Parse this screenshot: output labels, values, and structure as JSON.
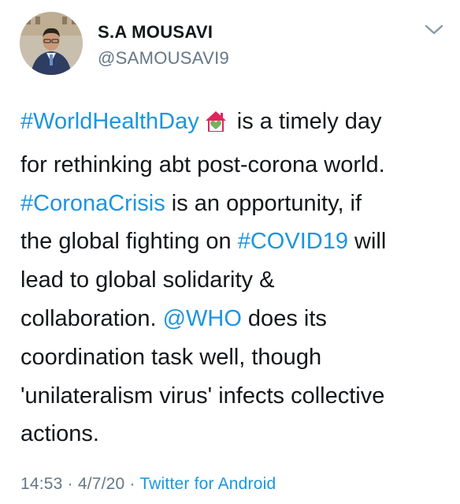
{
  "user": {
    "name": "S.A MOUSAVI",
    "handle": "@SAMOUSAVI9"
  },
  "icons": {
    "menu": "chevron-down-icon",
    "emoji": "house-with-heart-emoji",
    "avatar": "profile-photo"
  },
  "tweet": {
    "lines": [
      [
        {
          "t": "#WorldHealthDay",
          "link": true
        },
        {
          "emoji": true
        },
        {
          "t": " is a timely day"
        }
      ],
      [
        {
          "t": "for rethinking abt post-corona world."
        }
      ],
      [
        {
          "t": "#CoronaCrisis",
          "link": true
        },
        {
          "t": " is an opportunity, if"
        }
      ],
      [
        {
          "t": "the global fighting on "
        },
        {
          "t": "#COVID19",
          "link": true
        },
        {
          "t": " will"
        }
      ],
      [
        {
          "t": "lead to global solidarity &"
        }
      ],
      [
        {
          "t": "collaboration. "
        },
        {
          "t": "@WHO",
          "link": true
        },
        {
          "t": " does its"
        }
      ],
      [
        {
          "t": "coordination task well, though"
        }
      ],
      [
        {
          "t": "'unilateralism virus' infects collective"
        }
      ],
      [
        {
          "t": "actions."
        }
      ]
    ]
  },
  "meta": {
    "time": "14:53",
    "sep1": " · ",
    "date": "4/7/20",
    "sep2": " · ",
    "source": "Twitter for Android"
  },
  "colors": {
    "link": "#1b95e0",
    "secondary": "#657786",
    "text": "#14171a",
    "emoji_house": "#e0245e"
  }
}
